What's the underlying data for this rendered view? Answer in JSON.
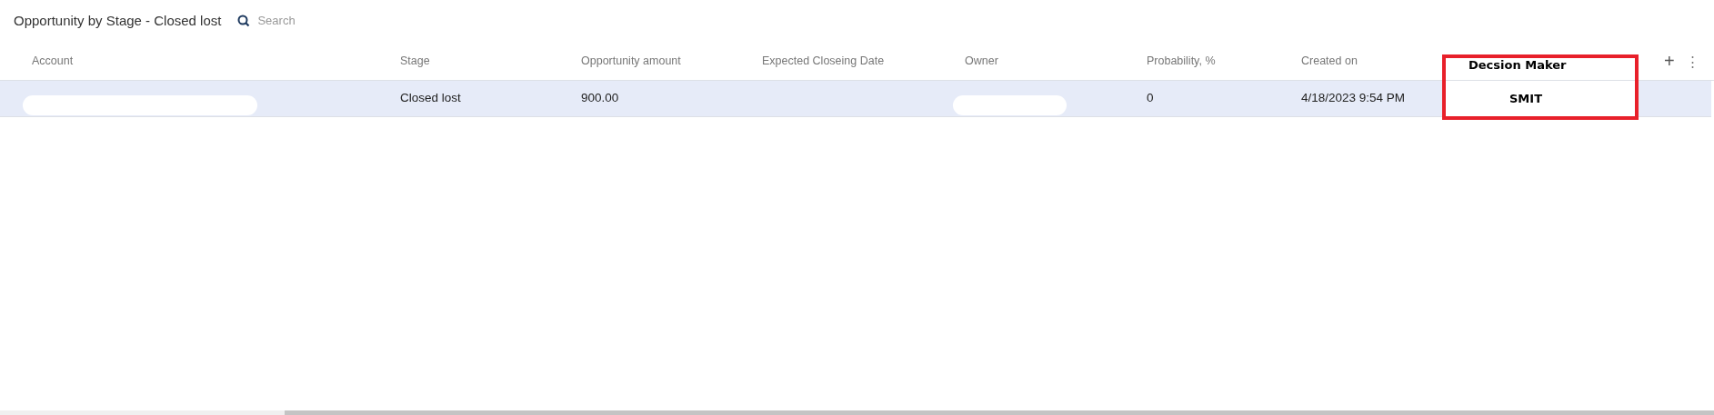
{
  "title": "Opportunity by Stage - Closed lost",
  "search": {
    "placeholder": "Search"
  },
  "table": {
    "columns": [
      {
        "label": "Account",
        "kind": "plain"
      },
      {
        "label": "Stage",
        "kind": "plain"
      },
      {
        "label": "Opportunity amount",
        "kind": "plain"
      },
      {
        "label": "Expected Closeing Date",
        "kind": "plain"
      },
      {
        "label": "Owner",
        "kind": "plain"
      },
      {
        "label": "Probability, %",
        "kind": "plain"
      },
      {
        "label": "Created on",
        "kind": "plain"
      },
      {
        "label": "Decsion Maker",
        "kind": "highlighted"
      }
    ],
    "rows": [
      {
        "selected": true,
        "cells": [
          {
            "kind": "redacted"
          },
          {
            "kind": "text",
            "text": "Closed lost"
          },
          {
            "kind": "text",
            "text": "900.00"
          },
          {
            "kind": "empty"
          },
          {
            "kind": "redacted"
          },
          {
            "kind": "text",
            "text": "0"
          },
          {
            "kind": "text",
            "text": "4/18/2023 9:54 PM"
          },
          {
            "kind": "text",
            "text": "SMIT"
          }
        ]
      }
    ]
  },
  "column_actions": {
    "add": "+",
    "more": "⋮"
  }
}
